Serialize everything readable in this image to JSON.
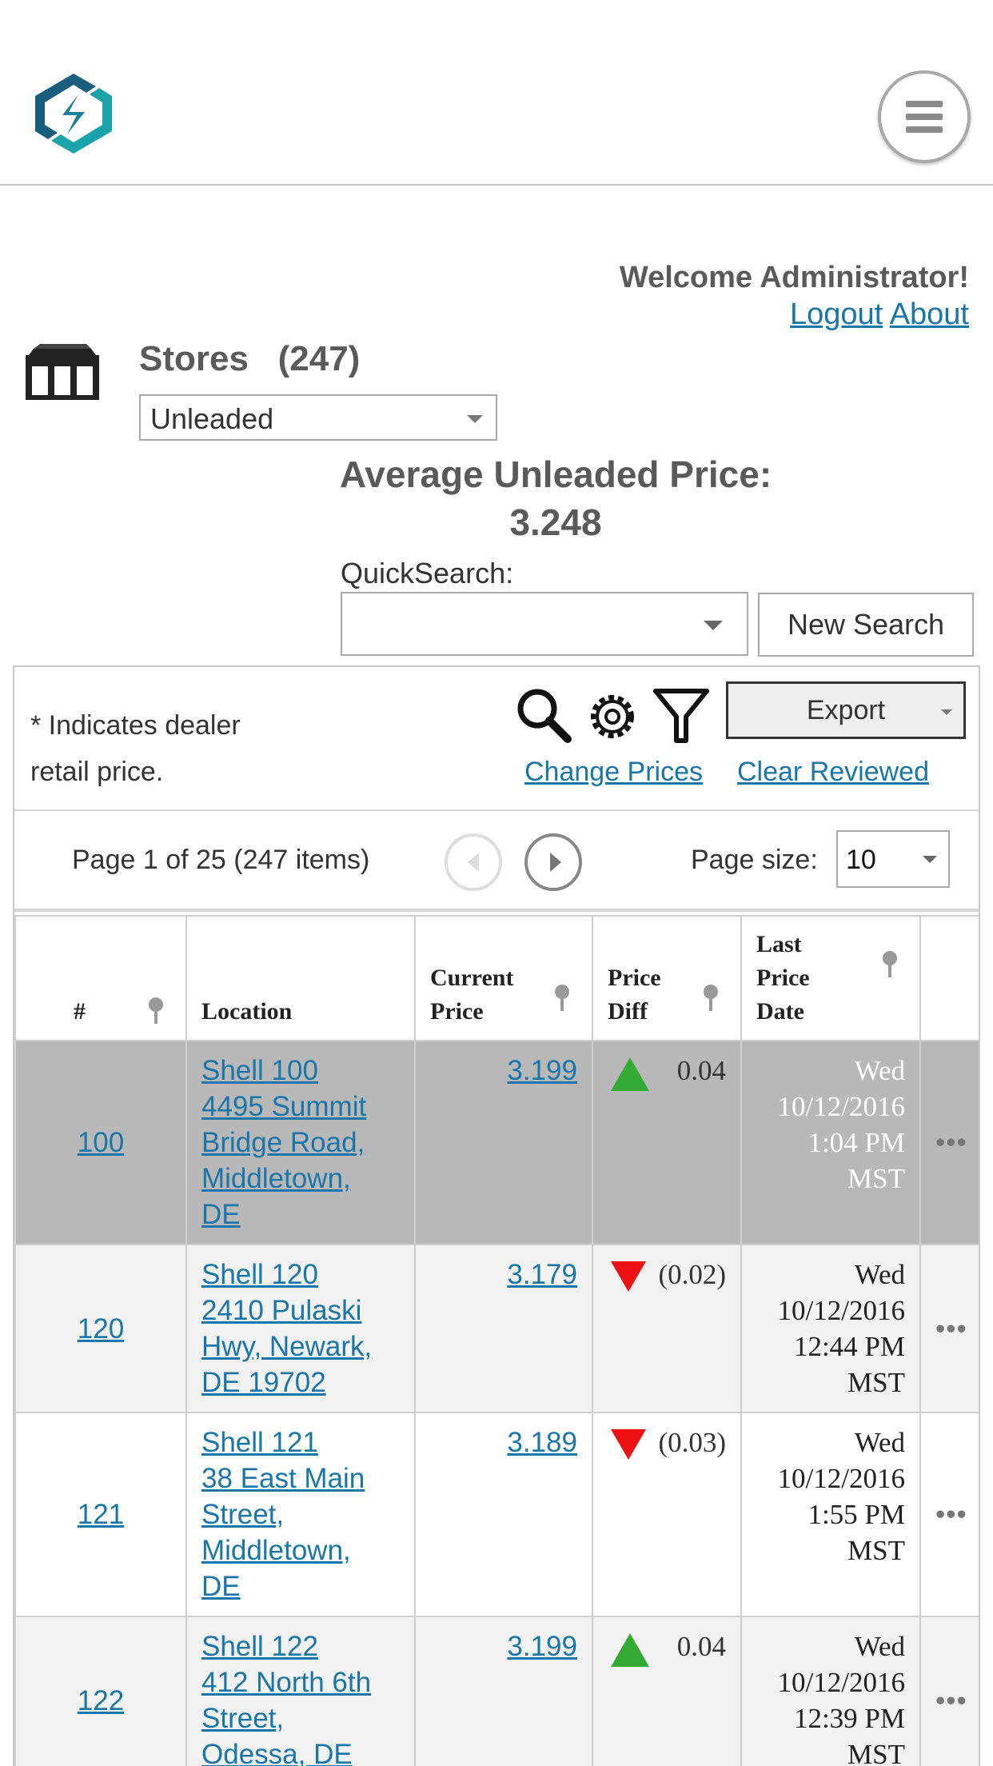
{
  "header": {
    "logo_icon": "brand-logo-icon",
    "menu_icon": "hamburger-menu-icon"
  },
  "user": {
    "welcome": "Welcome Administrator!",
    "logout": "Logout",
    "about": "About"
  },
  "stores": {
    "icon": "store-icon",
    "title": "Stores   (247)",
    "fuel_type": "Unleaded",
    "avg_label": "Average Unleaded Price:",
    "avg_value": "3.248"
  },
  "search": {
    "label": "QuickSearch:",
    "value": "",
    "new_search": "New Search"
  },
  "toolbar": {
    "note_line1": "* Indicates dealer",
    "note_line2": "retail price.",
    "search_icon": "magnifier-icon",
    "settings_icon": "gear-icon",
    "filter_icon": "filter-icon",
    "export": "Export",
    "change_prices": "Change Prices",
    "clear_reviewed": "Clear Reviewed"
  },
  "pager": {
    "info": "Page 1 of 25 (247 items)",
    "page_size_label": "Page size:",
    "page_size": "10"
  },
  "table": {
    "headers": {
      "num": "#",
      "location": "Location",
      "current_price_1": "Current",
      "current_price_2": "Price",
      "price_diff_1": "Price",
      "price_diff_2": "Diff",
      "last_date_1": "Last",
      "last_date_2": "Price",
      "last_date_3": "Date"
    },
    "rows": [
      {
        "num": "100",
        "loc1": "Shell 100",
        "loc2": "4495 Summit",
        "loc3": "Bridge Road,",
        "loc4": "Middletown,",
        "loc5": "DE",
        "price": "3.199",
        "trend": "up",
        "diff": "0.04",
        "d1": "Wed",
        "d2": "10/12/2016",
        "d3": "1:04 PM",
        "d4": "MST"
      },
      {
        "num": "120",
        "loc1": "Shell 120",
        "loc2": "2410 Pulaski",
        "loc3": "Hwy, Newark,",
        "loc4": "DE 19702",
        "loc5": "",
        "price": "3.179",
        "trend": "down",
        "diff": "(0.02)",
        "d1": "Wed",
        "d2": "10/12/2016",
        "d3": "12:44 PM",
        "d4": "MST"
      },
      {
        "num": "121",
        "loc1": "Shell 121",
        "loc2": "38 East Main",
        "loc3": "Street,",
        "loc4": "Middletown,",
        "loc5": "DE",
        "price": "3.189",
        "trend": "down",
        "diff": "(0.03)",
        "d1": "Wed",
        "d2": "10/12/2016",
        "d3": "1:55 PM",
        "d4": "MST"
      },
      {
        "num": "122",
        "loc1": "Shell 122",
        "loc2": "412 North 6th",
        "loc3": "Street,",
        "loc4": "Odessa, DE",
        "loc5": "",
        "price": "3.199",
        "trend": "up",
        "diff": "0.04",
        "d1": "Wed",
        "d2": "10/12/2016",
        "d3": "12:39 PM",
        "d4": "MST"
      }
    ],
    "more_label": "•••"
  },
  "colors": {
    "link": "#1a75a8",
    "selected_row": "#b8b8b8",
    "up": "#33aa33",
    "down": "#ee1111"
  }
}
